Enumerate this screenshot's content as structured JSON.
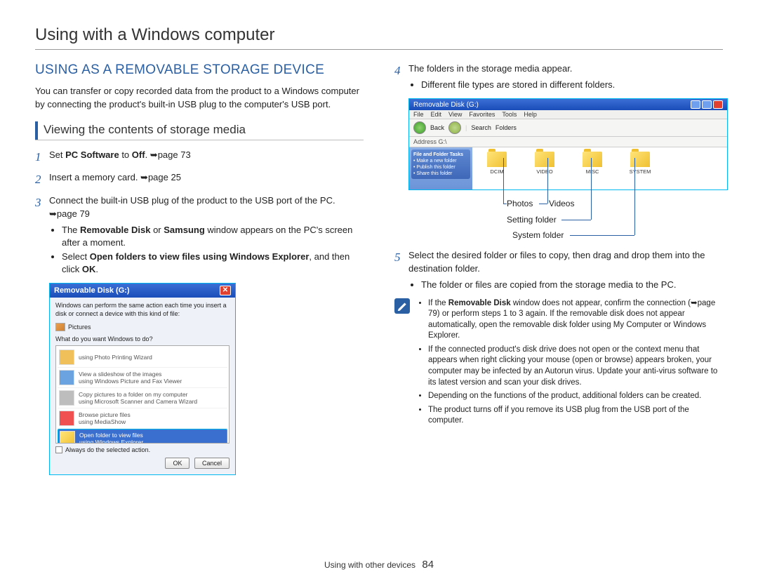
{
  "page_title": "Using with a Windows computer",
  "section_heading": "USING AS A REMOVABLE STORAGE DEVICE",
  "intro": "You can transfer or copy recorded data from the product to a Windows computer by connecting the product's built-in USB plug to the computer's USB port.",
  "sub_heading": "Viewing the contents of storage media",
  "steps_left": [
    {
      "num": "1",
      "parts": [
        "Set ",
        {
          "b": "PC Software"
        },
        " to ",
        {
          "b": "Off"
        },
        ". ",
        {
          "a": "➥"
        },
        "page 73"
      ]
    },
    {
      "num": "2",
      "parts": [
        "Insert a memory card. ",
        {
          "a": "➥"
        },
        "page 25"
      ]
    },
    {
      "num": "3",
      "parts": [
        "Connect the built-in USB plug of the product to the USB port of the PC. ",
        {
          "a": "➥"
        },
        "page 79"
      ],
      "bullets": [
        {
          "parts": [
            "The ",
            {
              "b": "Removable Disk"
            },
            " or ",
            {
              "b": "Samsung"
            },
            " window appears on the PC's screen after a moment."
          ]
        },
        {
          "parts": [
            "Select ",
            {
              "b": "Open folders to view files using Windows Explorer"
            },
            ", and then click ",
            {
              "b": "OK"
            },
            "."
          ]
        }
      ]
    }
  ],
  "dialog": {
    "title": "Removable Disk (G:)",
    "desc": "Windows can perform the same action each time you insert a disk or connect a device with this kind of file:",
    "pictures": "Pictures",
    "question": "What do you want Windows to do?",
    "items": [
      "using Photo Printing Wizard",
      "View a slideshow of the images\nusing Windows Picture and Fax Viewer",
      "Copy pictures to a folder on my computer\nusing Microsoft Scanner and Camera Wizard",
      "Browse picture files\nusing MediaShow"
    ],
    "highlight": "Open folder to view files\nusing Windows Explorer",
    "checkbox": "Always do the selected action.",
    "ok": "OK",
    "cancel": "Cancel"
  },
  "steps_right": [
    {
      "num": "4",
      "parts": [
        "The folders in the storage media appear."
      ],
      "bullets": [
        {
          "parts": [
            "Different file types are stored in different folders."
          ]
        }
      ]
    }
  ],
  "explorer": {
    "title": "Removable Disk (G:)",
    "menus": [
      "File",
      "Edit",
      "View",
      "Favorites",
      "Tools",
      "Help"
    ],
    "tool_labels": [
      "Back",
      "",
      "",
      "Search",
      "Folders"
    ],
    "address": "Address  G:\\",
    "side_title": "File and Folder Tasks",
    "side_items": [
      "Make a new folder",
      "Publish this folder",
      "Share this folder"
    ],
    "folders": [
      "DCIM",
      "VIDEO",
      "MISC",
      "SYSTEM"
    ]
  },
  "callouts": {
    "photos": "Photos",
    "videos": "Videos",
    "setting": "Setting folder",
    "system": "System folder"
  },
  "step5": {
    "num": "5",
    "parts": [
      "Select the desired folder or files to copy, then drag and drop them into the destination folder."
    ],
    "bullets": [
      {
        "parts": [
          "The folder or files are copied from the storage media to the PC."
        ]
      }
    ]
  },
  "notes": [
    {
      "parts": [
        "If the ",
        {
          "b": "Removable Disk"
        },
        " window does not appear, confirm the connection (",
        {
          "a": "➥"
        },
        "page 79) or perform steps 1 to 3 again. If the removable disk does not appear automatically, open the removable disk folder using My Computer or Windows Explorer."
      ]
    },
    {
      "parts": [
        "If the connected product's disk drive does not open or the context menu that appears when right clicking your mouse (open or browse) appears broken, your computer may be infected by an Autorun virus. Update your anti-virus software to its latest version and scan your disk drives."
      ]
    },
    {
      "parts": [
        "Depending on the functions of the product, additional folders can be created."
      ]
    },
    {
      "parts": [
        "The product turns off if you remove its USB plug from the USB port of the computer."
      ]
    }
  ],
  "footer_section": "Using with other devices",
  "footer_page": "84"
}
